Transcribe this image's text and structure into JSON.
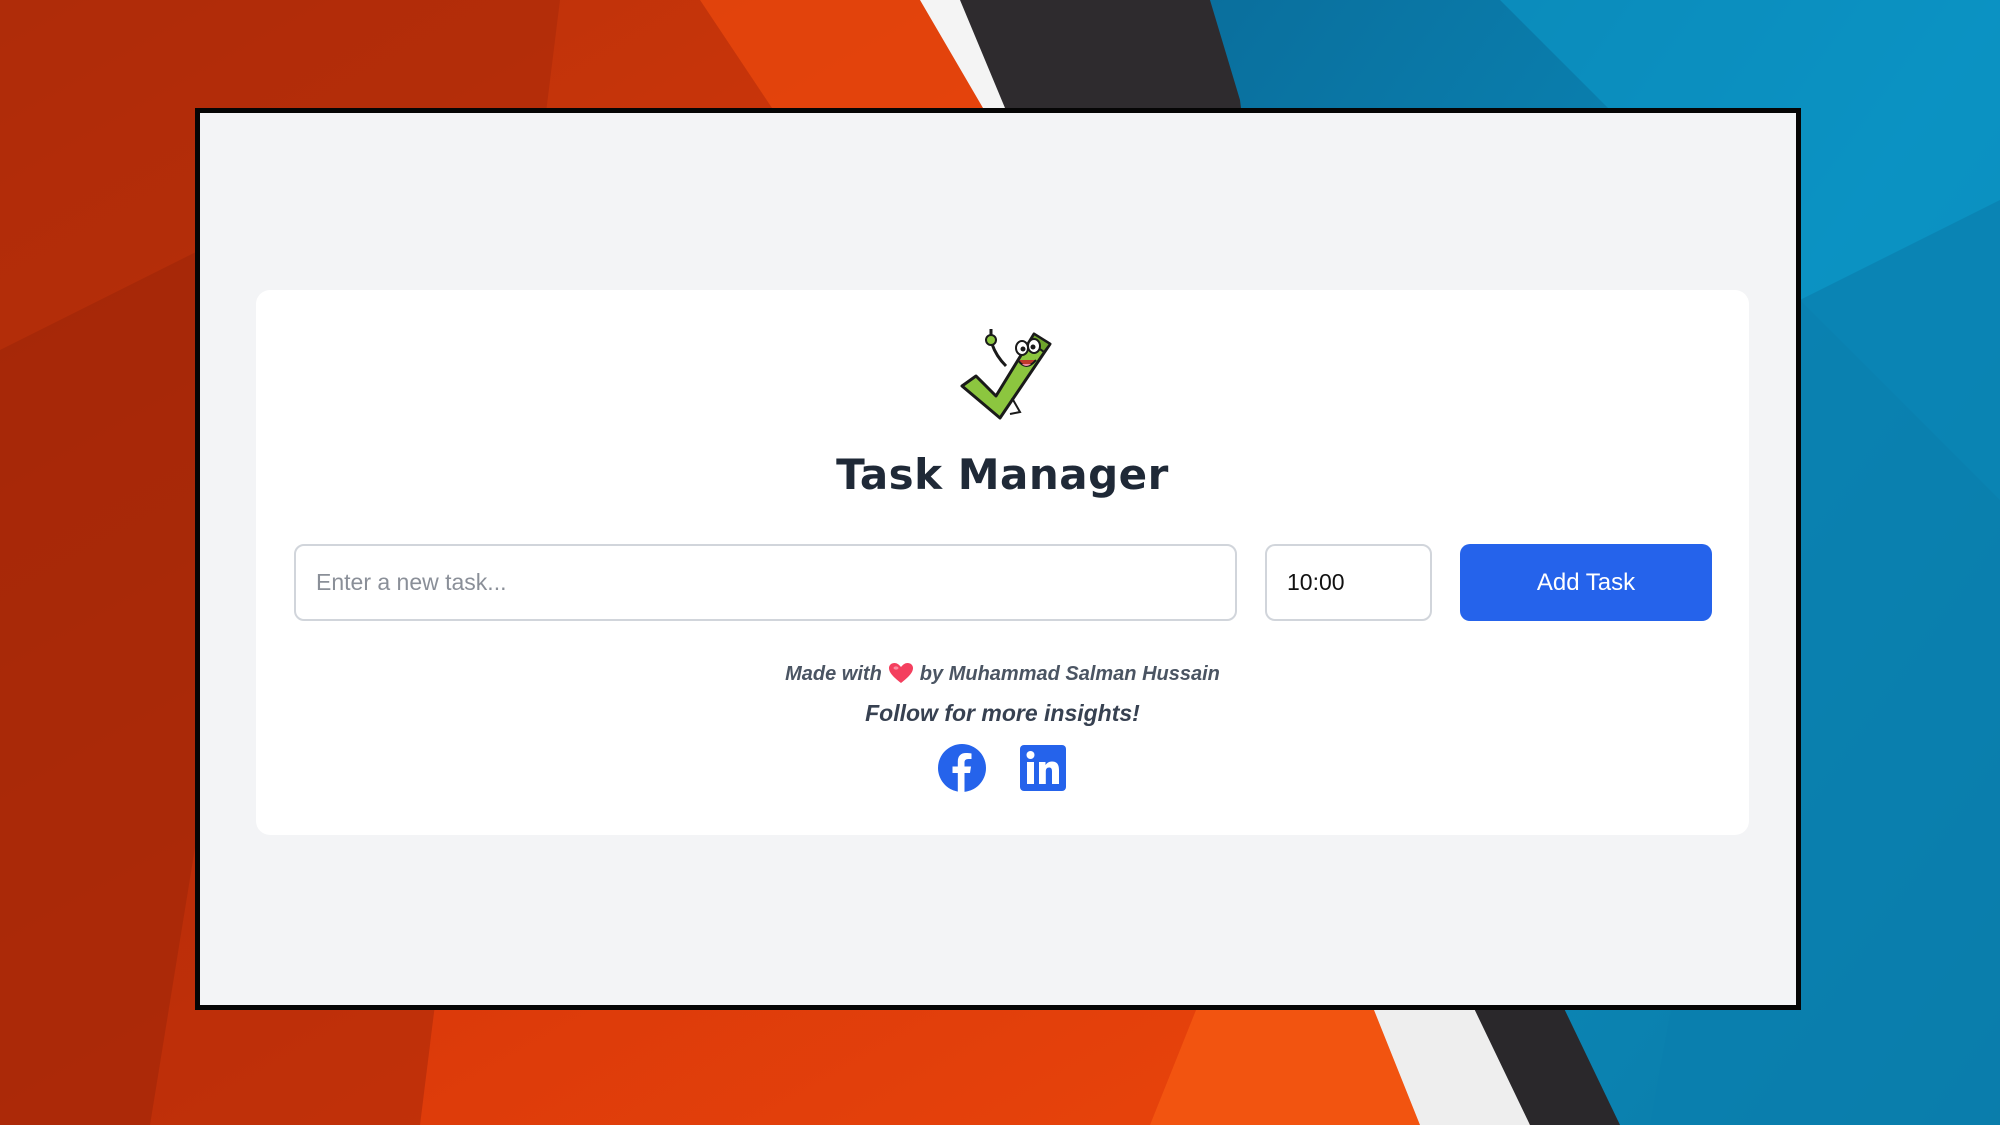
{
  "app": {
    "title": "Task Manager"
  },
  "form": {
    "task_placeholder": "Enter a new task...",
    "task_value": "",
    "time_value": "10:00",
    "add_label": "Add Task"
  },
  "footer": {
    "made_with": "Made with",
    "by_author": "by Muhammad Salman Hussain",
    "follow": "Follow for more insights!",
    "heart_icon": "heart-icon",
    "socials": [
      {
        "name": "facebook-icon"
      },
      {
        "name": "linkedin-icon"
      }
    ]
  },
  "colors": {
    "accent": "#2563eb",
    "page_bg": "#f3f4f6",
    "card_bg": "#ffffff",
    "heart": "#f43f5e",
    "logo_green": "#8cc63f"
  }
}
